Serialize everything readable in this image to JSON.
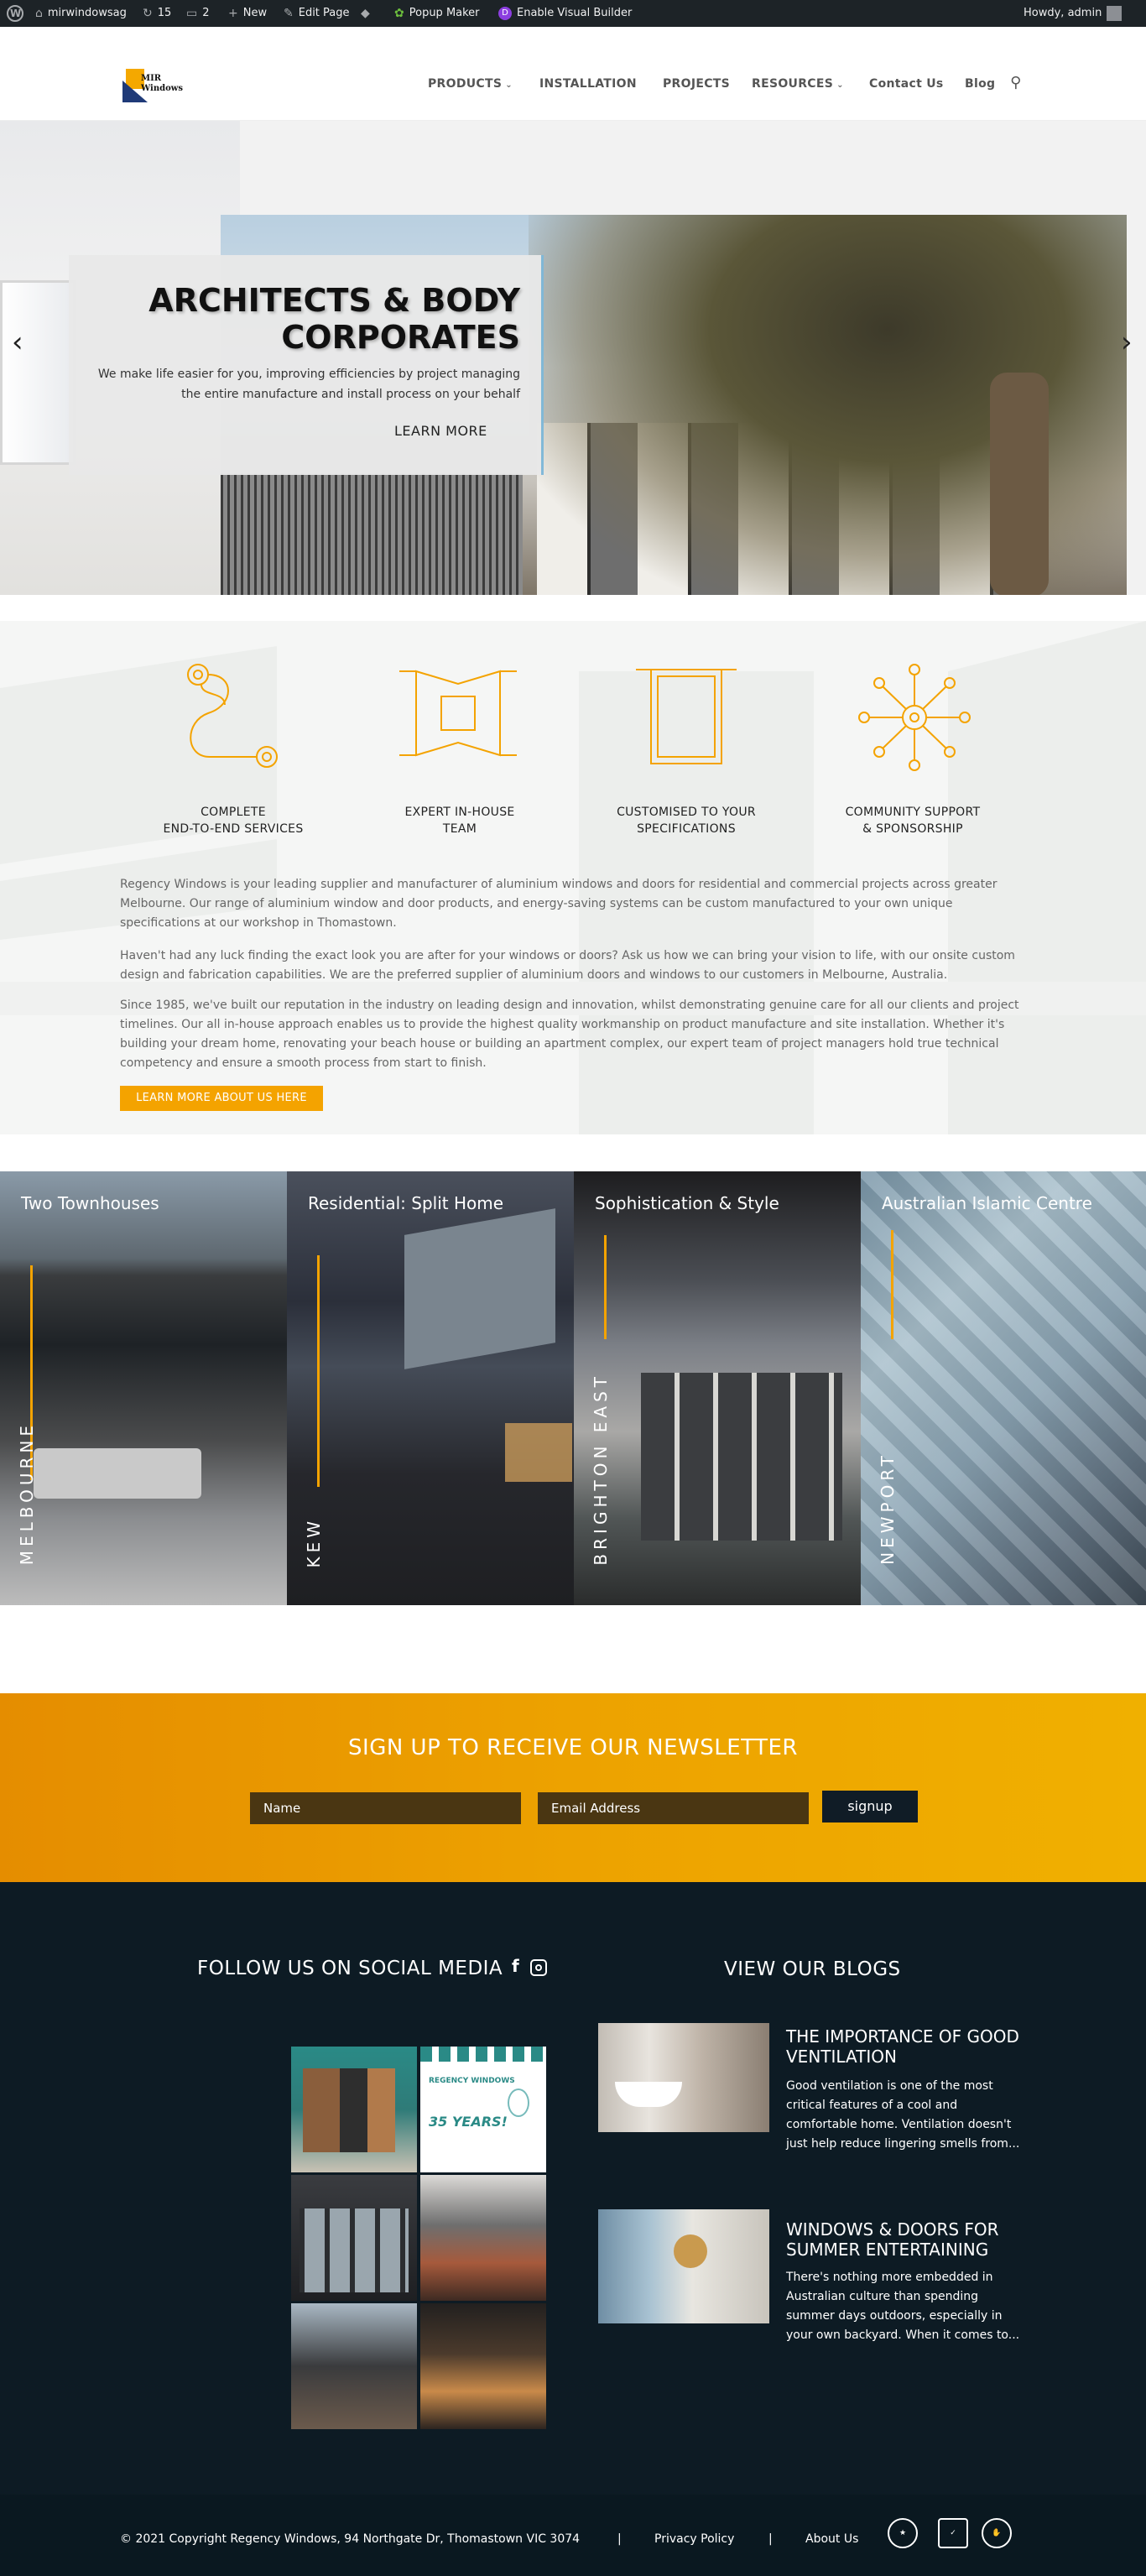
{
  "adminbar": {
    "site": "mirwindowsag",
    "updates": "15",
    "comments": "2",
    "new": "New",
    "edit_page": "Edit Page",
    "popup": "Popup Maker",
    "visual_builder": "Enable Visual Builder",
    "howdy": "Howdy, admin"
  },
  "header": {
    "logo_line1": "MIR",
    "logo_line2": "Windows",
    "nav": [
      "PRODUCTS",
      "INSTALLATION",
      "PROJECTS",
      "RESOURCES",
      "Contact Us",
      "Blog"
    ]
  },
  "hero": {
    "title_line1": "ARCHITECTS & BODY",
    "title_line2": "CORPORATES",
    "subtitle_line1": "We make life easier for you, improving efficiencies by project managing",
    "subtitle_line2": "the entire manufacture and install process on your behalf",
    "cta": "LEARN MORE"
  },
  "features": {
    "items": [
      {
        "line1": "COMPLETE",
        "line2": "END-TO-END SERVICES",
        "icon": "path-icon"
      },
      {
        "line1": "EXPERT IN-HOUSE",
        "line2": "TEAM",
        "icon": "window-icon"
      },
      {
        "line1": "CUSTOMISED TO YOUR",
        "line2": "SPECIFICATIONS",
        "icon": "frame-icon"
      },
      {
        "line1": "COMMUNITY SUPPORT",
        "line2": "& SPONSORSHIP",
        "icon": "network-icon"
      }
    ],
    "p1": "Regency Windows is your leading supplier and manufacturer of aluminium windows and doors for residential and commercial projects across greater Melbourne. Our range of aluminium window and door products, and energy-saving systems can be custom manufactured to your own unique specifications at our workshop in Thomastown.",
    "p2": "Haven't had any luck finding the exact look you are after for your windows or doors? Ask us how we can bring your vision to life, with our onsite custom design and fabrication capabilities. We are the preferred supplier of aluminium doors and windows to our customers in Melbourne, Australia.",
    "p3": "Since 1985, we've built our reputation in the industry on leading design and innovation, whilst demonstrating genuine care for all our clients and project timelines. Our all in-house approach enables us to provide the highest quality workmanship on product manufacture and site installation. Whether it's building your dream home, renovating your beach house or building an apartment complex, our expert team of project managers hold true technical competency and ensure a smooth process from start to finish.",
    "button": "LEARN MORE ABOUT US HERE",
    "accent": "#f4a300"
  },
  "projects": [
    {
      "title": "Two Townhouses",
      "location": "MELBOURNE"
    },
    {
      "title": "Residential: Split Home",
      "location": "KEW"
    },
    {
      "title": "Sophistication & Style",
      "location": "BRIGHTON EAST"
    },
    {
      "title": "Australian Islamic Centre",
      "location": "NEWPORT"
    }
  ],
  "newsletter": {
    "title": "SIGN UP TO RECEIVE OUR NEWSLETTER",
    "name_placeholder": "Name",
    "email_placeholder": "Email Address",
    "button": "signup"
  },
  "social": {
    "title": "FOLLOW US ON SOCIAL MEDIA",
    "tile2_brand": "REGENCY WINDOWS",
    "tile2_years": "35 YEARS!"
  },
  "blogs": {
    "title": "VIEW OUR BLOGS",
    "posts": [
      {
        "title": "THE IMPORTANCE OF GOOD VENTILATION",
        "excerpt": "Good ventilation is one of the most critical features of a cool and comfortable home. Ventilation doesn't just help reduce lingering smells from..."
      },
      {
        "title": "WINDOWS & DOORS FOR SUMMER ENTERTAINING",
        "excerpt": "There's nothing more embedded in Australian culture than spending summer days outdoors, especially in your own backyard. When it comes to..."
      }
    ]
  },
  "footer": {
    "copyright": "© 2021 Copyright Regency Windows, 94 Northgate Dr, Thomastown VIC 3074",
    "sep": "|",
    "privacy": "Privacy Policy",
    "about": "About Us"
  }
}
